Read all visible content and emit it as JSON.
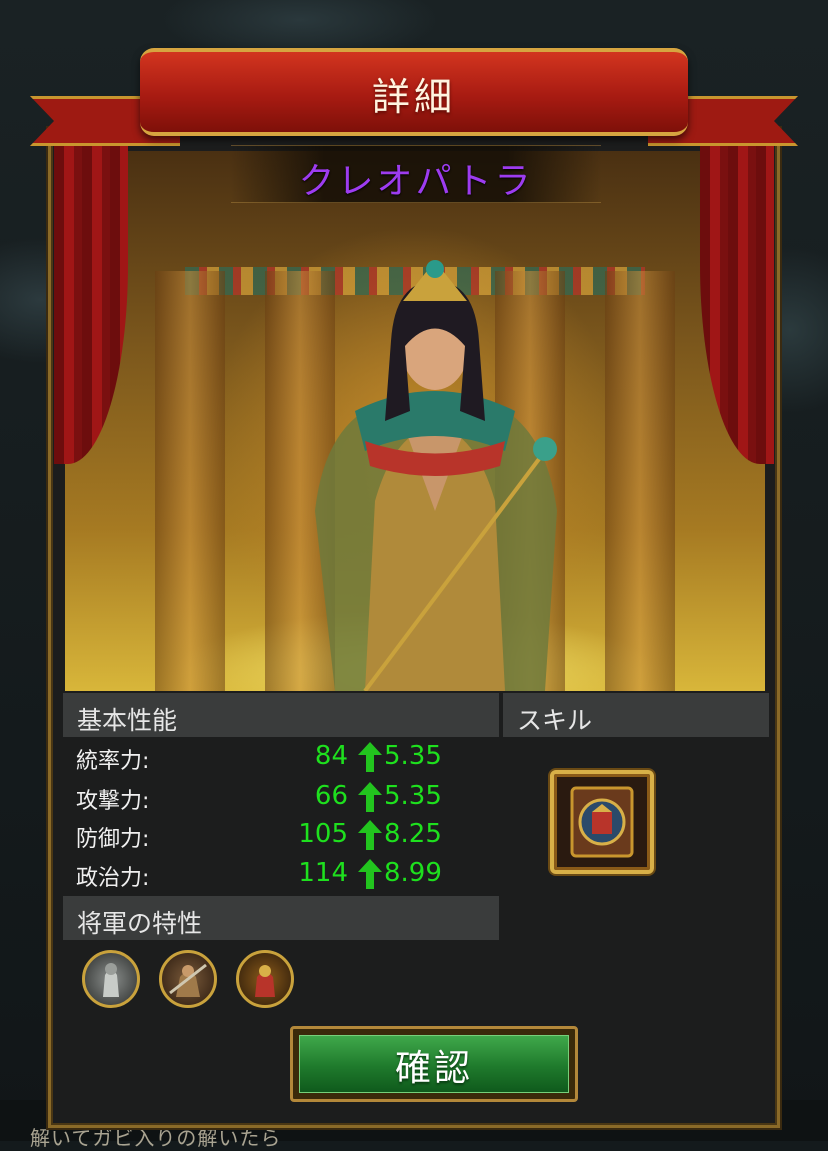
{
  "dialog": {
    "title": "詳細",
    "general_name": "クレオパトラ",
    "confirm_label": "確認"
  },
  "stats": {
    "header": "基本性能",
    "rows": [
      {
        "label": "統率力:",
        "value": "84",
        "increase": "5.35"
      },
      {
        "label": "攻撃力:",
        "value": "66",
        "increase": "5.35"
      },
      {
        "label": "防御力:",
        "value": "105",
        "increase": "8.25"
      },
      {
        "label": "政治力:",
        "value": "114",
        "increase": "8.99"
      }
    ]
  },
  "skills": {
    "header": "スキル",
    "icons": [
      "skill-book-icon"
    ]
  },
  "traits": {
    "header": "将軍の特性",
    "icons": [
      "trait-knight-icon",
      "trait-warrior-icon",
      "trait-soldier-icon"
    ]
  },
  "background_text": "解いてガビ入りの解いたら",
  "colors": {
    "name": "#9d3cf0",
    "stat_value": "#1ee01e",
    "ribbon": "#a81b12",
    "confirm": "#1f7a2c"
  }
}
